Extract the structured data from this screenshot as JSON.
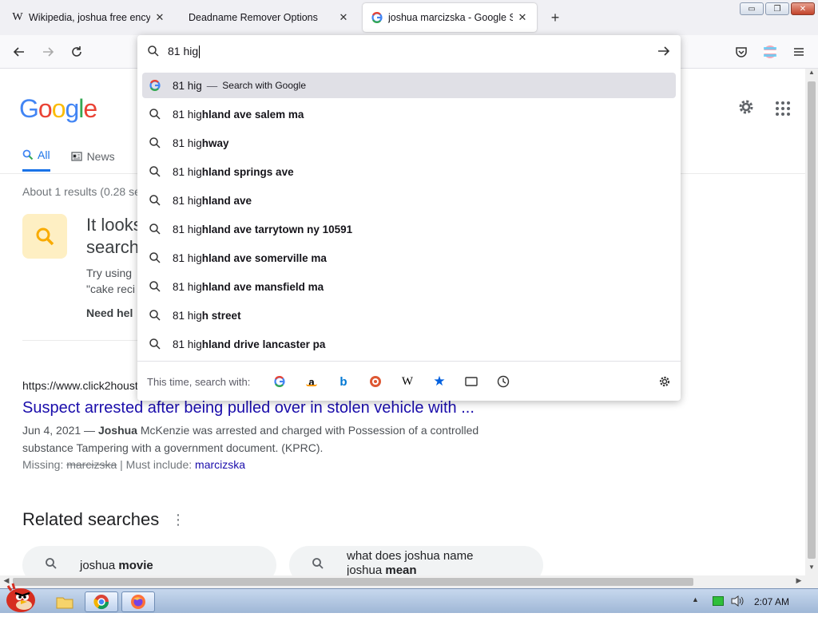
{
  "browser": {
    "tabs": [
      {
        "title": "Wikipedia, joshua free encyclop",
        "icon": "wikipedia-icon"
      },
      {
        "title": "Deadname Remover Options",
        "icon": "none"
      },
      {
        "title": "joshua marcizska - Google Sear",
        "icon": "google-icon",
        "active": true
      }
    ],
    "new_tab": "+",
    "window": {
      "minimize": "▭",
      "restore": "❐",
      "close": "✕"
    }
  },
  "urlbar": {
    "value": "81 hig",
    "top_suggestion": {
      "typed": "81 hig",
      "separator": "—",
      "action": "Search with Google"
    },
    "suggestions": [
      {
        "typed": "81 hig",
        "rest": "hland ave salem ma"
      },
      {
        "typed": "81 hig",
        "rest": "hway"
      },
      {
        "typed": "81 hig",
        "rest": "hland springs ave"
      },
      {
        "typed": "81 hig",
        "rest": "hland ave"
      },
      {
        "typed": "81 hig",
        "rest": "hland ave tarrytown ny 10591"
      },
      {
        "typed": "81 hig",
        "rest": "hland ave somerville ma"
      },
      {
        "typed": "81 hig",
        "rest": "hland ave mansfield ma"
      },
      {
        "typed": "81 hig",
        "rest": "h street"
      },
      {
        "typed": "81 hig",
        "rest": "hland drive lancaster pa"
      }
    ],
    "this_time": "This time, search with:"
  },
  "google": {
    "logo": "Google",
    "tabs": {
      "all": "All",
      "news": "News"
    },
    "stats": "About 1 results (0.28 se",
    "tip_title_1": "It looks",
    "tip_title_2": "search",
    "tip_text_1": "Try using",
    "tip_text_2": "\"cake reci",
    "need_help": "Need hel",
    "result": {
      "url": "https://www.click2houst",
      "title": "Suspect arrested after being pulled over in stolen vehicle with ...",
      "date": "Jun 4, 2021 — ",
      "bold": "Joshua",
      "snippet_1": " McKenzie was arrested and charged with Possession of a controlled",
      "snippet_2": "substance Tampering with a government document. (KPRC).",
      "missing_label": "Missing: ",
      "missing_word": "marcizska",
      "must_include_label": " | Must include: ",
      "must_include_word": "marcizska"
    },
    "related": {
      "heading": "Related searches",
      "items": [
        {
          "plain": "joshua ",
          "bold": "movie"
        },
        {
          "plain_1": "what does joshua name",
          "plain_2": "joshua ",
          "bold": "mean"
        }
      ]
    }
  },
  "taskbar": {
    "clock": "2:07 AM"
  },
  "colors": {
    "link": "#1a0dab",
    "accent": "#1a73e8",
    "tab_strip": "#f0f0f4"
  }
}
